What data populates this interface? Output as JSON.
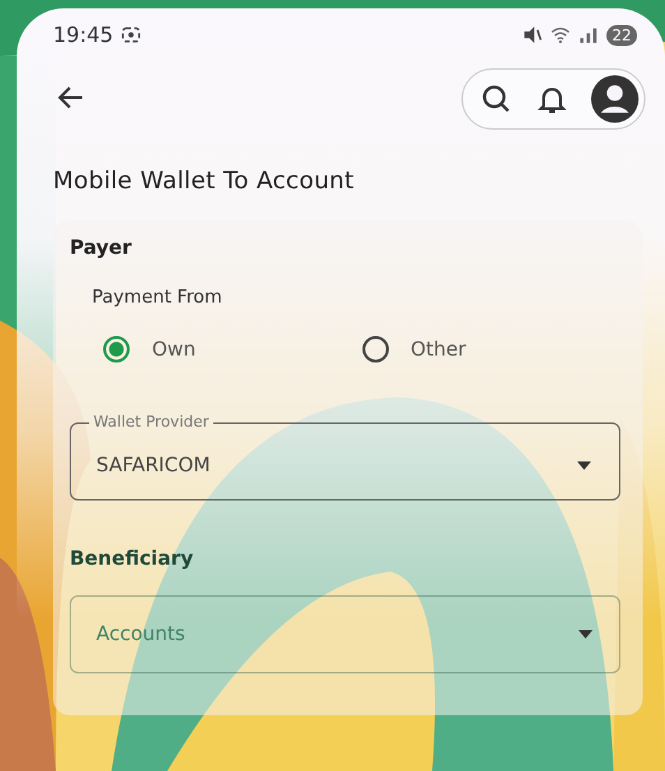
{
  "status_bar": {
    "time": "19:45",
    "battery": "22"
  },
  "header": {
    "title": "Mobile Wallet To Account"
  },
  "payer": {
    "heading": "Payer",
    "payment_from": {
      "label": "Payment From",
      "options": [
        {
          "label": "Own",
          "selected": true
        },
        {
          "label": "Other",
          "selected": false
        }
      ]
    },
    "wallet_provider": {
      "label": "Wallet Provider",
      "value": "SAFARICOM"
    }
  },
  "beneficiary": {
    "heading": "Beneficiary",
    "account": {
      "placeholder": "Accounts"
    }
  }
}
